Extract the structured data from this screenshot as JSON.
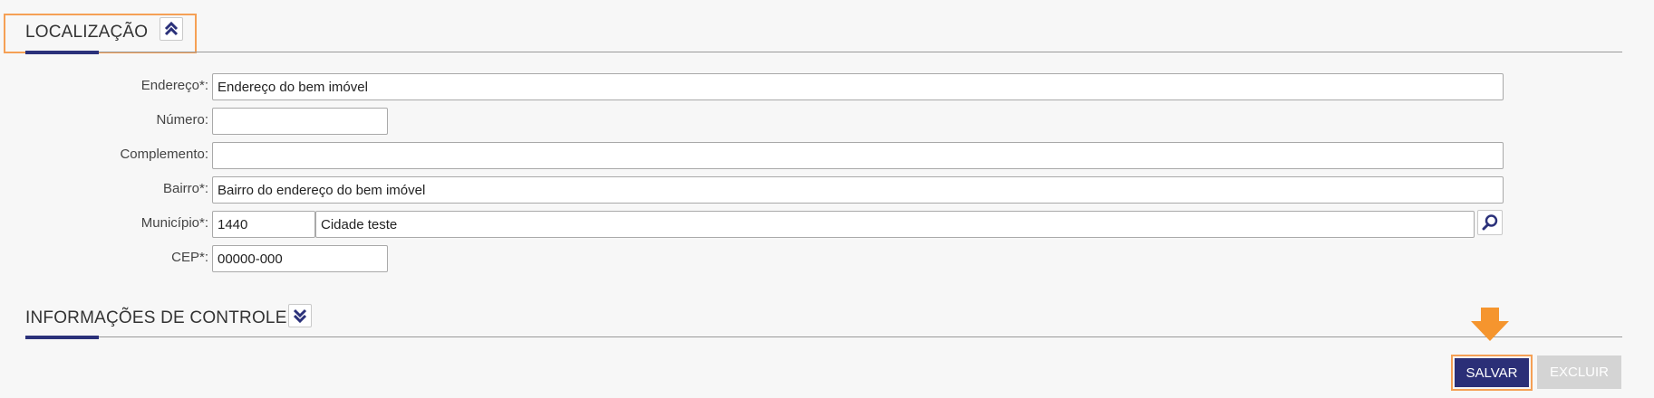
{
  "localizacao": {
    "title": "LOCALIZAÇÃO",
    "fields": {
      "endereco": {
        "label": "Endereço*:",
        "value": "Endereço do bem imóvel"
      },
      "numero": {
        "label": "Número:",
        "value": ""
      },
      "complemento": {
        "label": "Complemento:",
        "value": ""
      },
      "bairro": {
        "label": "Bairro*:",
        "value": "Bairro do endereço do bem imóvel"
      },
      "municipio": {
        "label": "Município*:",
        "code": "1440",
        "name": "Cidade teste"
      },
      "cep": {
        "label": "CEP*:",
        "value": "00000-000"
      }
    }
  },
  "informacoes_controle": {
    "title": "INFORMAÇÕES DE CONTROLE"
  },
  "actions": {
    "save_label": "SALVAR",
    "delete_label": "EXCLUIR"
  },
  "colors": {
    "primary": "#2b2f77",
    "highlight": "#f5a055",
    "disabled": "#d4d4d4"
  }
}
